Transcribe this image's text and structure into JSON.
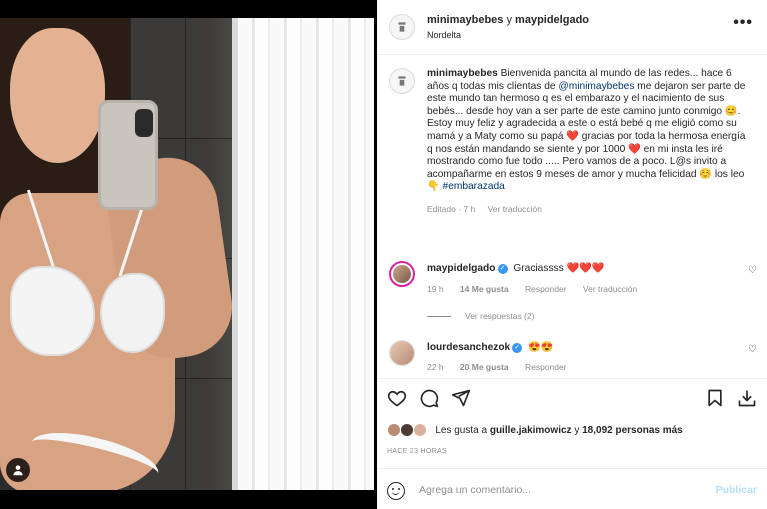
{
  "post": {
    "header": {
      "username": "minimaybebes",
      "conjunction": "y",
      "coauthor": "maypidelgado",
      "location": "Nordelta",
      "more_icon": "more-horizontal-icon"
    },
    "caption": {
      "username": "minimaybebes",
      "part1": "Bienvenida pancita al mundo de las redes... hace 6 años q todas mis clientas de",
      "mention": "@minimaybebes",
      "part2": "me dejaron ser parte de este mundo tan hermoso q es el embarazo y el nacimiento de sus bebés... desde hoy van a ser parte de este camino junto conmigo 😊.",
      "part3": "Estoy muy feliz y agradecida a este o está bebé q me eligió como su mamá y a Maty como su papá ❤️ gracias por toda la hermosa energía q nos están mandando se siente y por 1000 ❤️ en mi insta les iré mostrando como fue todo ..... Pero vamos de a poco. L@s invito a acompañarme en estos 9 meses de amor y mucha felicidad ☺️ los leo 👇",
      "hashtag": "#embarazada",
      "edited": "Editado · 7 h",
      "translate": "Ver traducción"
    },
    "comments": [
      {
        "username": "maypidelgado",
        "verified": true,
        "text": "Graciassss ❤️❤️❤️",
        "time": "19 h",
        "likes": "14 Me gusta",
        "reply": "Responder",
        "translate": "Ver traducción",
        "replies_label": "Ver respuestas (2)"
      },
      {
        "username": "lourdesanchezok",
        "verified": true,
        "text": "😍😍",
        "time": "22 h",
        "likes": "20 Me gusta",
        "reply": "Responder"
      }
    ],
    "actions": {
      "like_icon": "heart-icon",
      "comment_icon": "comment-icon",
      "share_icon": "share-icon",
      "save_icon": "bookmark-icon",
      "download_icon": "download-icon"
    },
    "likes": {
      "prefix": "Les gusta a",
      "user": "guille.jakimowicz",
      "middle": "y",
      "count": "18,092 personas más"
    },
    "timestamp": "HACE 23 HORAS",
    "comment_box": {
      "placeholder": "Agrega un comentario...",
      "publish": "Publicar"
    }
  },
  "colors": {
    "link": "#00376b",
    "verified": "#3897f0",
    "publish_disabled": "#b2dffc",
    "meta_gray": "#8e8e8e"
  }
}
